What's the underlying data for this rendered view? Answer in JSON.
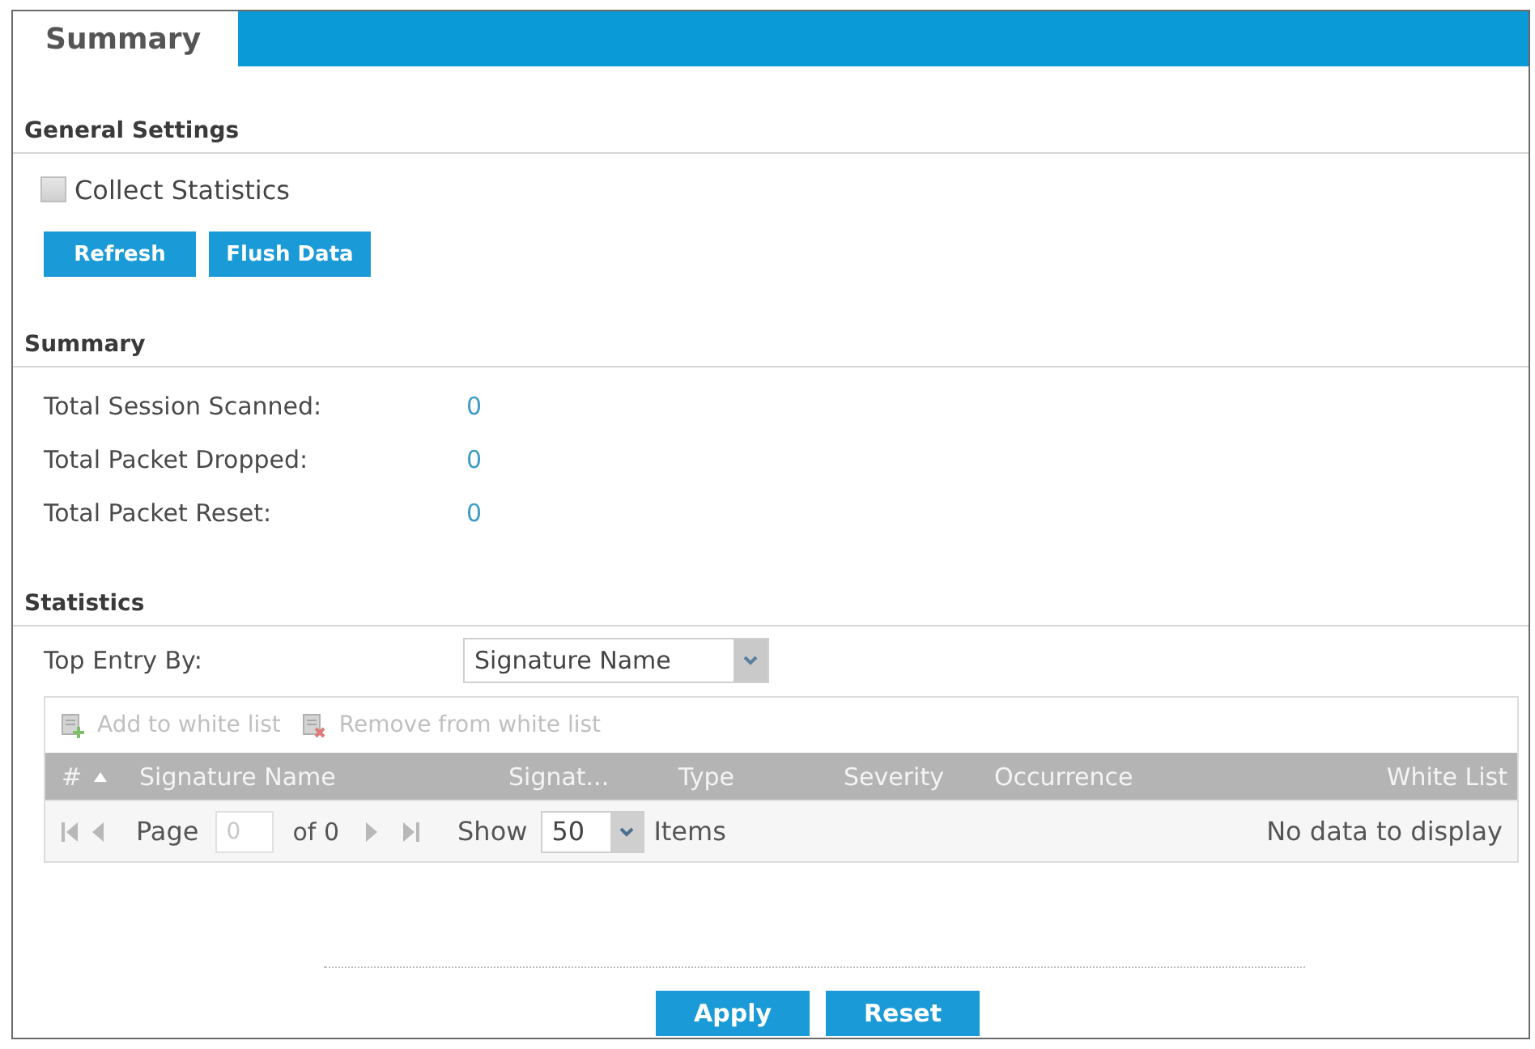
{
  "tabs": [
    {
      "label": "Summary",
      "selected": true
    }
  ],
  "general_settings": {
    "heading": "General Settings",
    "collect_statistics": {
      "label": "Collect Statistics",
      "checked": false
    },
    "buttons": [
      "Refresh",
      "Flush Data"
    ]
  },
  "summary": {
    "heading": "Summary",
    "rows": [
      {
        "label": "Total Session Scanned:",
        "value": "0"
      },
      {
        "label": "Total Packet Dropped:",
        "value": "0"
      },
      {
        "label": "Total Packet Reset:",
        "value": "0"
      }
    ]
  },
  "statistics": {
    "heading": "Statistics",
    "top_entry_by": {
      "label": "Top Entry By:",
      "value": "Signature Name"
    },
    "toolbar": [
      {
        "kind": "add",
        "label": "Add to white list",
        "disabled": true
      },
      {
        "kind": "remove",
        "label": "Remove from white list",
        "disabled": true
      }
    ],
    "table": {
      "columns": [
        {
          "label": "#",
          "sorted": true
        },
        {
          "label": "Signature Name",
          "sorted": false
        },
        {
          "label": "Signat...",
          "sorted": false
        },
        {
          "label": "Type",
          "sorted": false
        },
        {
          "label": "Severity",
          "sorted": false
        },
        {
          "label": "Occurrence",
          "sorted": false
        },
        {
          "label": "White List",
          "sorted": false
        }
      ],
      "pager": {
        "page_label": "Page",
        "page": "0",
        "of_label": "of 0",
        "show_label": "Show",
        "page_size": "50",
        "items_label": "Items",
        "status": "No data to display"
      }
    }
  },
  "buttons": [
    "Apply",
    "Reset"
  ]
}
